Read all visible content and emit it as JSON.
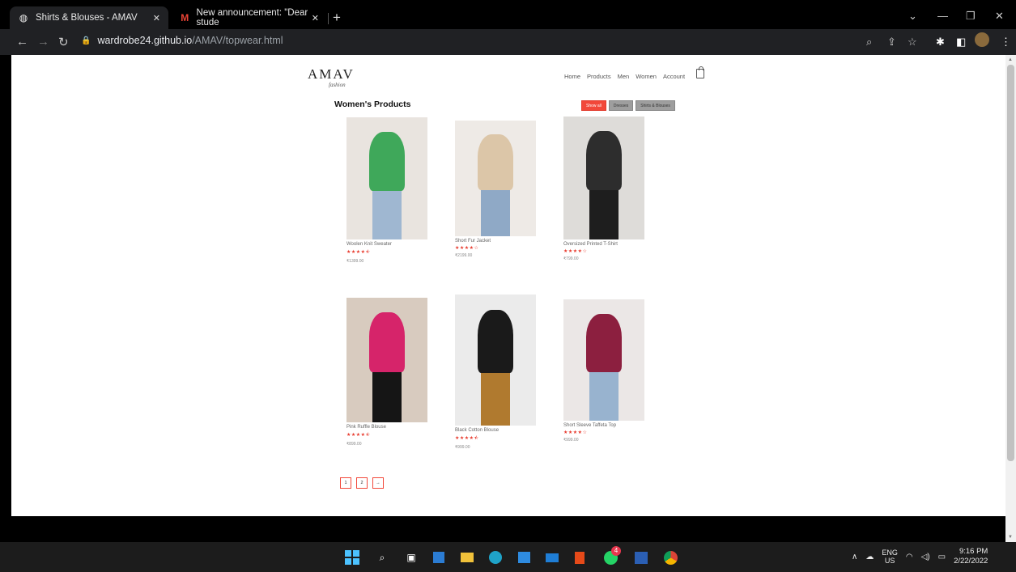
{
  "browser": {
    "tabs": [
      {
        "title": "Shirts & Blouses - AMAV",
        "favicon": "globe-icon",
        "active": true
      },
      {
        "title": "New announcement: \"Dear stude",
        "favicon": "gmail-icon",
        "active": false
      }
    ],
    "new_tab": "+",
    "url_host": "wardrobe24.github.io",
    "url_path": "/AMAV/topwear.html"
  },
  "site": {
    "logo": "AMAV",
    "logo_sub": "fashion",
    "nav": [
      "Home",
      "Products",
      "Men",
      "Women",
      "Account"
    ]
  },
  "section_title": "Women's Products",
  "filters": [
    {
      "label": "Show all",
      "active": true
    },
    {
      "label": "Dresses",
      "active": false
    },
    {
      "label": "Shirts & Blouses",
      "active": false
    }
  ],
  "products": [
    {
      "name": "Woolen Knit Sweater",
      "rating": "★★★★⯪",
      "price": "₹1399.00",
      "colors": [
        "#e9e4df",
        "#3fa85a",
        "#9fb7d1"
      ]
    },
    {
      "name": "Short Fur Jacket",
      "rating": "★★★★☆",
      "price": "₹2199.00",
      "colors": [
        "#eeeae6",
        "#dcc6a8",
        "#8fa9c6"
      ]
    },
    {
      "name": "Oversized Printed T-Shirt",
      "rating": "★★★★☆",
      "price": "₹799.00",
      "colors": [
        "#dedcd9",
        "#2d2d2d",
        "#1e1e1e"
      ]
    },
    {
      "name": "Pink Ruffle Blouse",
      "rating": "★★★★⯪",
      "price": "₹899.00",
      "colors": [
        "#d8cbbf",
        "#d6246a",
        "#151515"
      ]
    },
    {
      "name": "Black Cotton Blouse",
      "rating": "★★★★⯪",
      "price": "₹999.00",
      "colors": [
        "#ebebeb",
        "#1a1a1a",
        "#b07a2f"
      ]
    },
    {
      "name": "Short Sleeve Taffeta Top",
      "rating": "★★★★☆",
      "price": "₹999.00",
      "colors": [
        "#ebe7e6",
        "#8c1f3f",
        "#98b3cf"
      ]
    }
  ],
  "pagination": [
    "1",
    "2",
    "→"
  ],
  "taskbar": {
    "lang_top": "ENG",
    "lang_bottom": "US",
    "time": "9:16 PM",
    "date": "2/22/2022",
    "badge": "4"
  }
}
